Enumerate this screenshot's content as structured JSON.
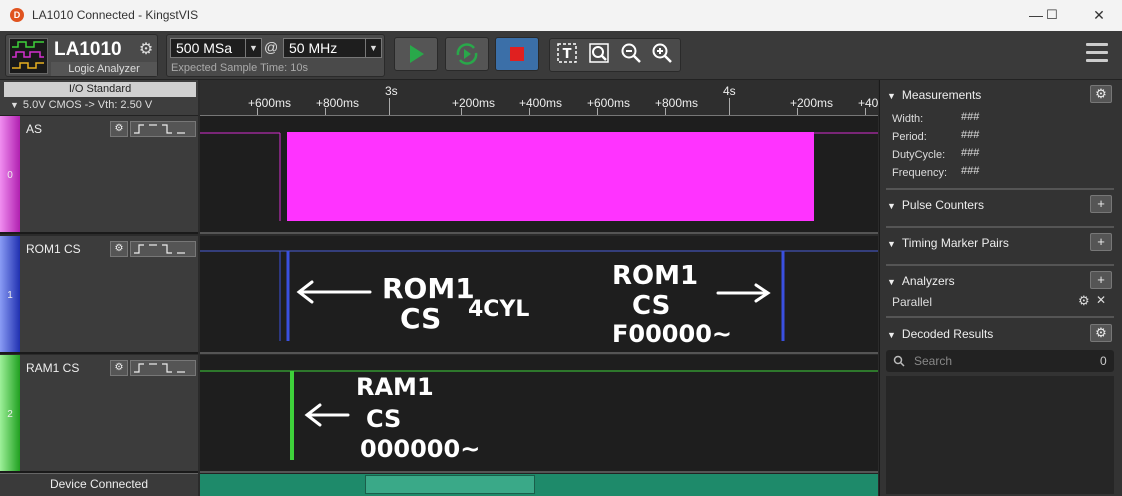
{
  "window": {
    "title": "LA1010 Connected - KingstVIS",
    "minimize": "—",
    "maximize": "☐",
    "close": "✕"
  },
  "toolbar": {
    "device_name": "LA1010",
    "device_subtitle": "Logic Analyzer",
    "sample_depth": "500 MSa",
    "at_symbol": "@",
    "sample_rate": "50 MHz",
    "expected_time": "Expected Sample Time: 10s",
    "colors": {
      "start": "#29a84a",
      "loop": "#29a84a",
      "stop": "#e02020",
      "stop_bg": "#3b6fa8"
    }
  },
  "io_standard": {
    "title": "I/O Standard",
    "value": "5.0V CMOS  -> Vth:  2.50 V"
  },
  "ruler": {
    "ticks": [
      "+600ms",
      "+800ms",
      "3s",
      "+200ms",
      "+400ms",
      "+600ms",
      "+800ms",
      "4s",
      "+200ms",
      "+40"
    ]
  },
  "channels": [
    {
      "num": "0",
      "name": "AS",
      "color": "#d52fd0"
    },
    {
      "num": "1",
      "name": "ROM1 CS",
      "color": "#4a5fd8"
    },
    {
      "num": "2",
      "name": "RAM1 CS",
      "color": "#3ed13a"
    }
  ],
  "annotations": {
    "rom_left_line1": "ROM1",
    "rom_left_line2": "CS",
    "rom_left_extra": "4CYL",
    "rom_right_line1": "ROM1",
    "rom_right_line2": "CS",
    "rom_right_line3": "F00000~",
    "ram_line1": "RAM1",
    "ram_line2": "CS",
    "ram_line3": "000000~"
  },
  "status": "Device Connected",
  "right_panel": {
    "measurements": {
      "title": "Measurements",
      "rows": [
        {
          "label": "Width:",
          "value": "###"
        },
        {
          "label": "Period:",
          "value": "###"
        },
        {
          "label": "DutyCycle:",
          "value": "###"
        },
        {
          "label": "Frequency:",
          "value": "###"
        }
      ]
    },
    "pulse_counters": "Pulse Counters",
    "timing_markers": "Timing Marker Pairs",
    "analyzers": {
      "title": "Analyzers",
      "item": "Parallel"
    },
    "decoded": {
      "title": "Decoded Results",
      "search_placeholder": "Search",
      "count": "0"
    }
  }
}
